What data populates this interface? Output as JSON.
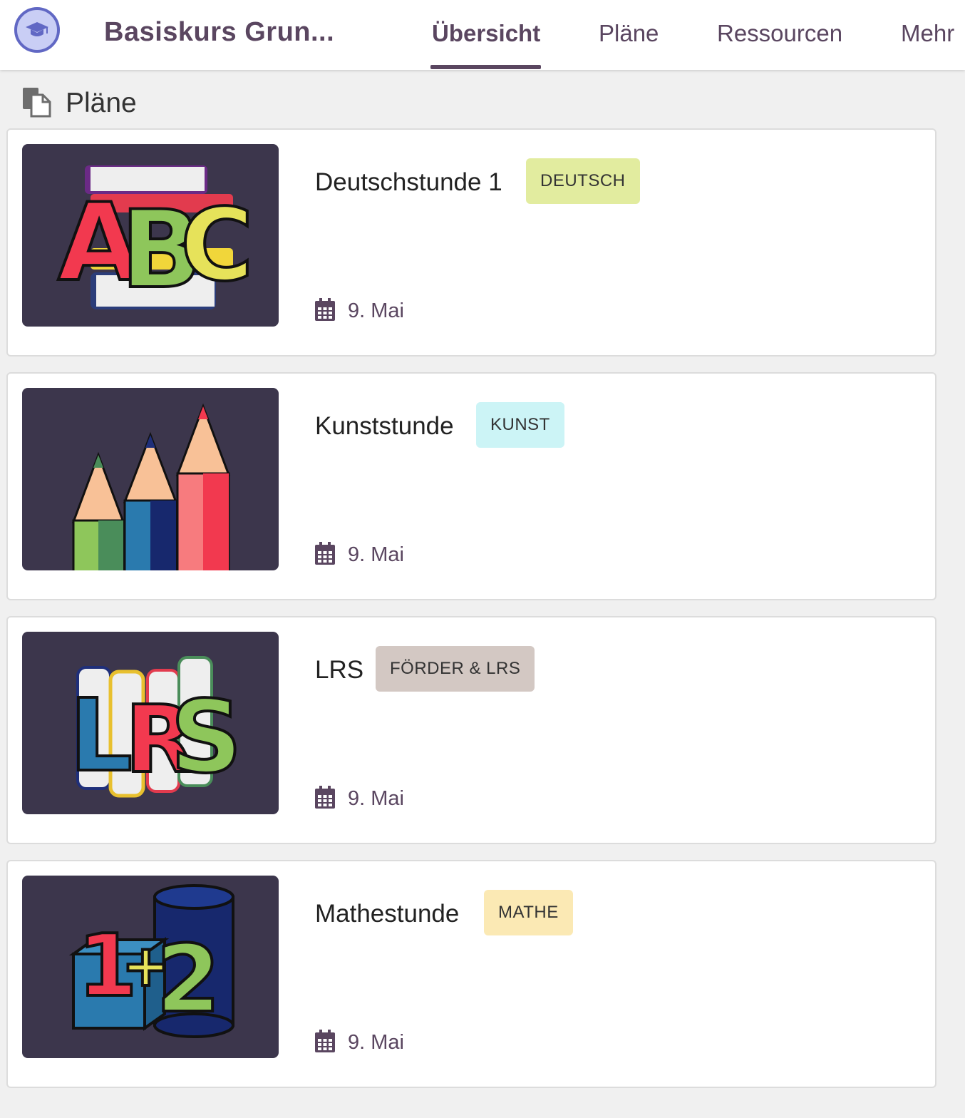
{
  "header": {
    "course_title": "Basiskurs Grun...",
    "tabs": [
      {
        "label": "Übersicht",
        "active": true
      },
      {
        "label": "Pläne",
        "active": false
      },
      {
        "label": "Ressourcen",
        "active": false
      },
      {
        "label": "Mehr",
        "active": false
      }
    ]
  },
  "section": {
    "title": "Pläne",
    "icon": "document-copy-icon"
  },
  "plans": [
    {
      "title": "Deutschstunde 1",
      "badge": "DEUTSCH",
      "badge_color": "#e2ec9f",
      "date": "9. Mai",
      "thumbnail": "abc-books"
    },
    {
      "title": "Kunststunde",
      "badge": "KUNST",
      "badge_color": "#ccf4f6",
      "date": "9. Mai",
      "thumbnail": "colored-pencils"
    },
    {
      "title": "LRS",
      "badge": "FÖRDER & LRS",
      "badge_color": "#d3c8c3",
      "date": "9. Mai",
      "thumbnail": "lrs-books"
    },
    {
      "title": "Mathestunde",
      "badge": "MATHE",
      "badge_color": "#fbe9b4",
      "date": "9. Mai",
      "thumbnail": "math-blocks"
    }
  ],
  "colors": {
    "brand": "#5a4660",
    "thumbnail_bg": "#3c364c",
    "course_icon_bg": "#c9cef5",
    "course_icon_border": "#6168c4"
  }
}
